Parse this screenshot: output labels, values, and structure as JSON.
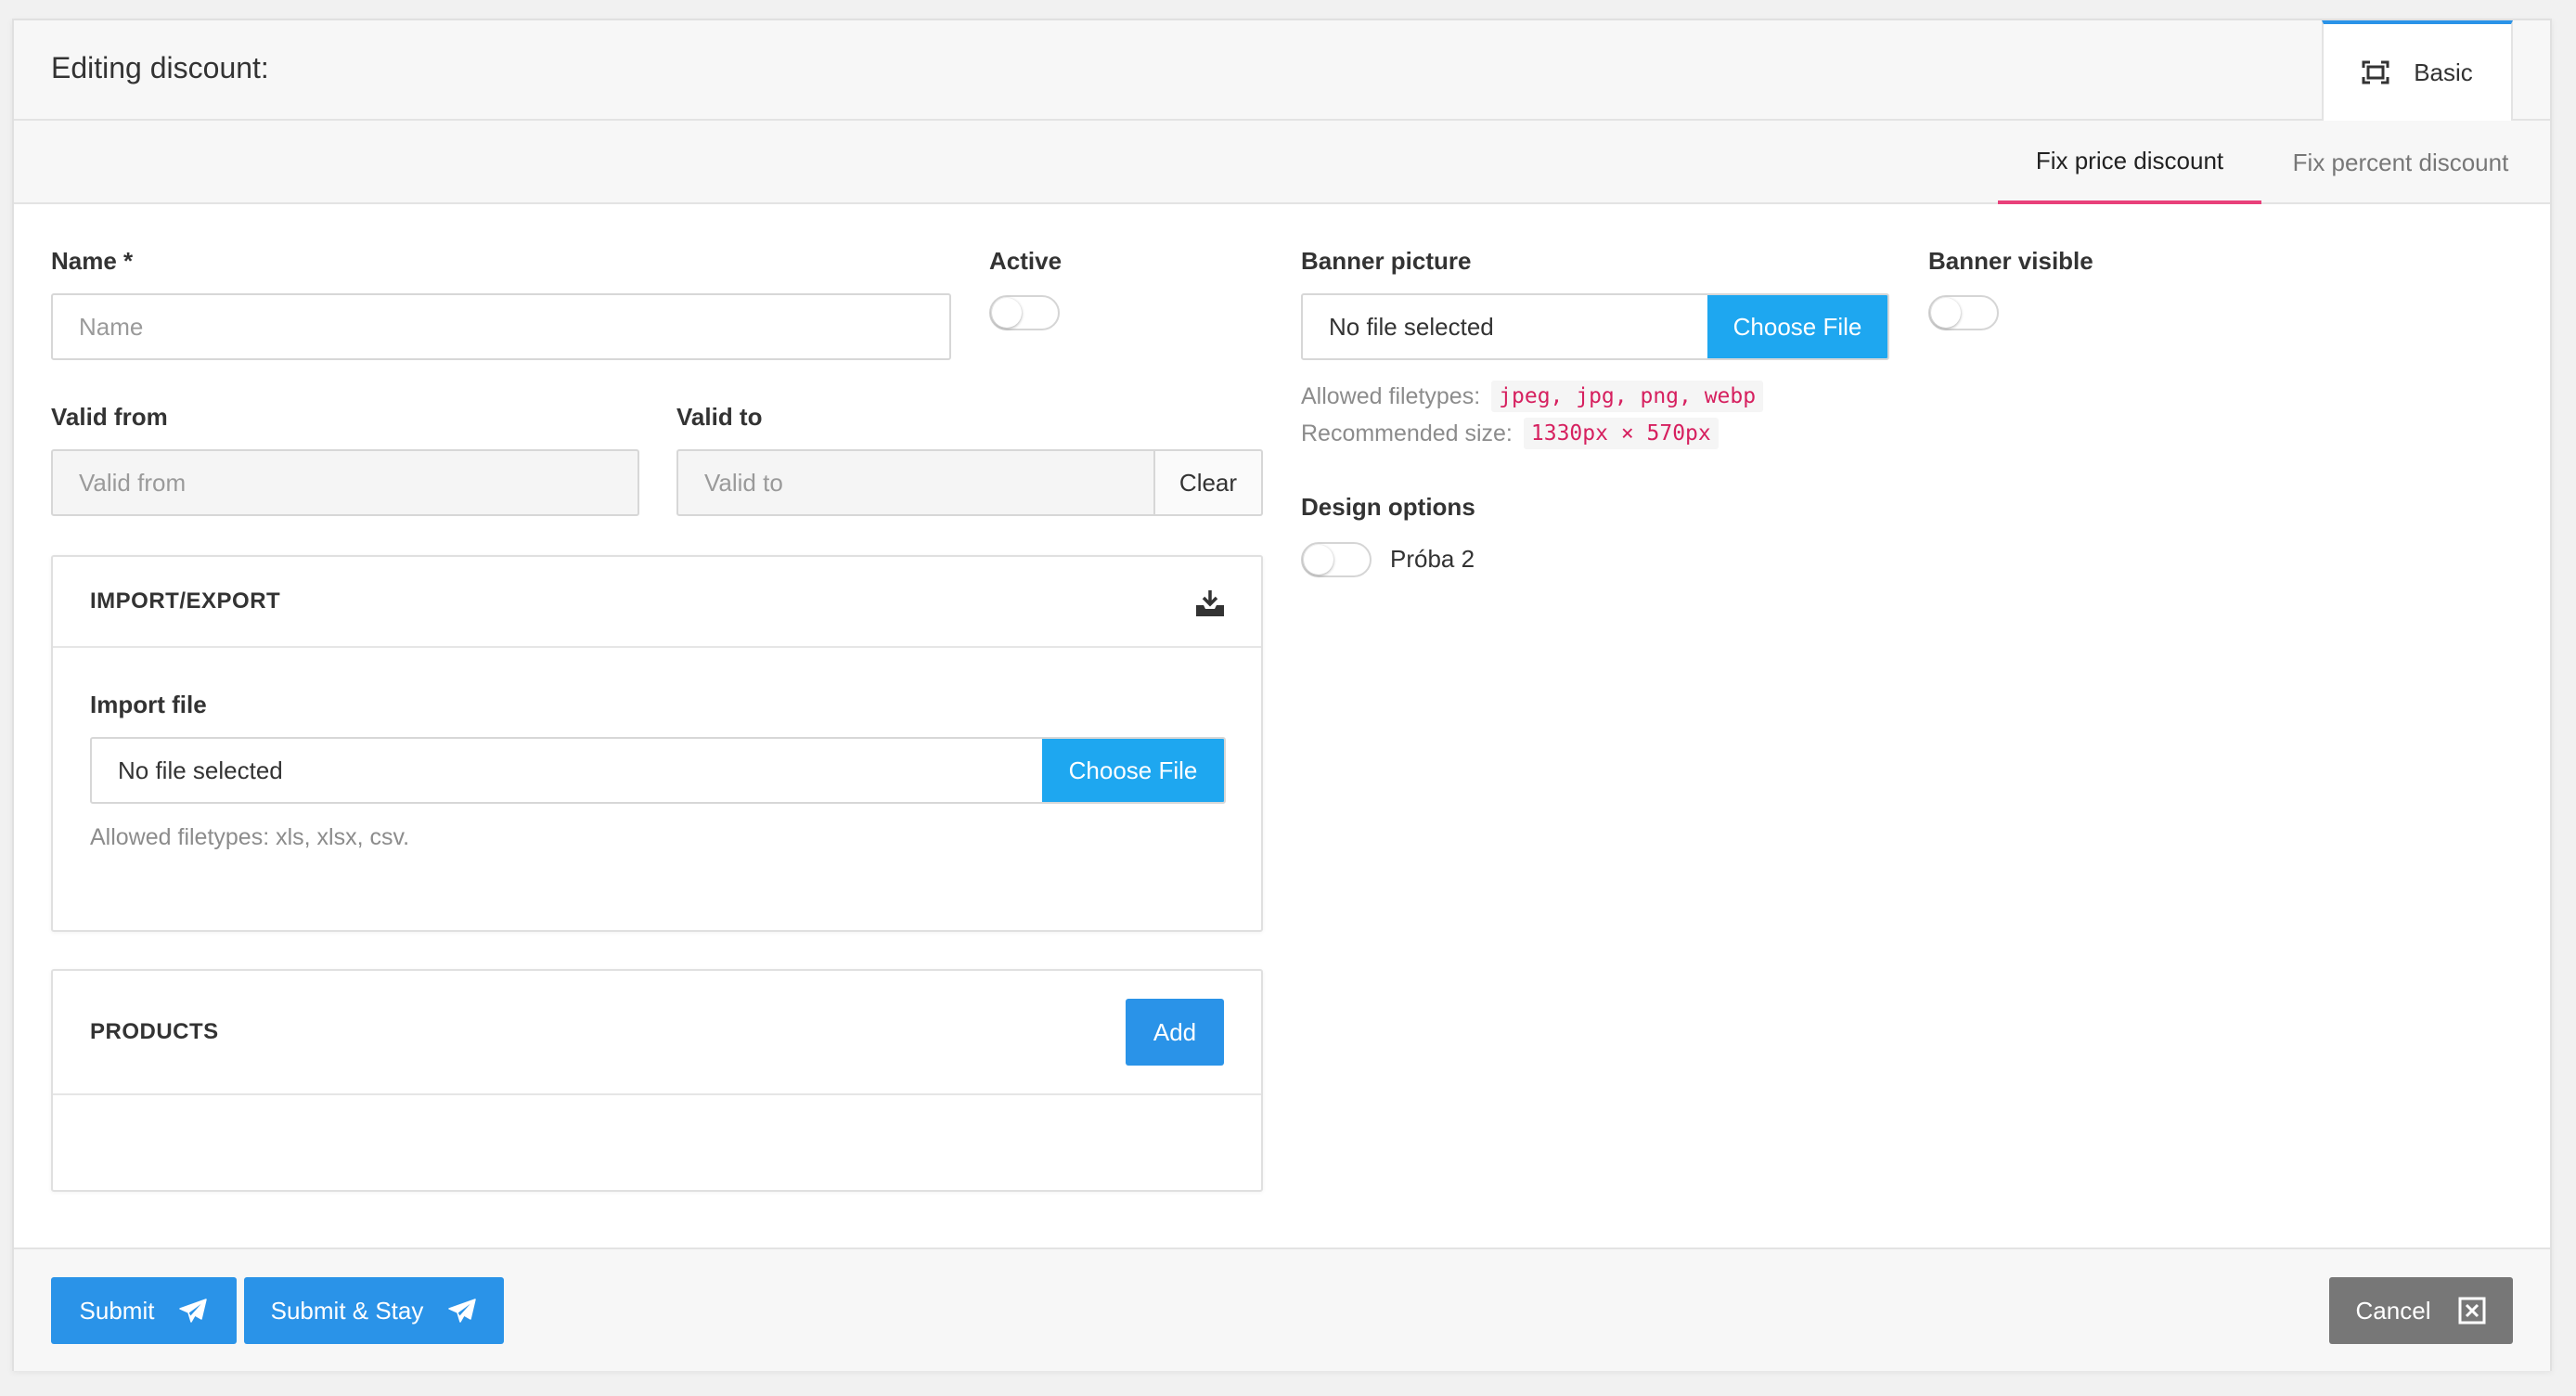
{
  "header": {
    "title": "Editing discount:",
    "view_tab": {
      "label": "Basic",
      "icon": "fullscreen-icon"
    }
  },
  "subtabs": [
    {
      "label": "Fix price discount",
      "active": true
    },
    {
      "label": "Fix percent discount",
      "active": false
    }
  ],
  "form": {
    "name": {
      "label": "Name *",
      "placeholder": "Name",
      "value": ""
    },
    "active": {
      "label": "Active",
      "on": false
    },
    "valid_from": {
      "label": "Valid from",
      "placeholder": "Valid from"
    },
    "valid_to": {
      "label": "Valid to",
      "placeholder": "Valid to",
      "clear_label": "Clear"
    },
    "banner_picture": {
      "label": "Banner picture",
      "file_text": "No file selected",
      "button_label": "Choose File",
      "allowed_label": "Allowed filetypes:",
      "allowed_value": "jpeg, jpg, png, webp",
      "size_label": "Recommended size:",
      "size_value": "1330px × 570px"
    },
    "banner_visible": {
      "label": "Banner visible",
      "on": false
    },
    "design_options": {
      "label": "Design options",
      "options": [
        {
          "label": "Próba 2",
          "on": false
        }
      ]
    }
  },
  "import_export": {
    "title": "IMPORT/EXPORT",
    "icon": "download-tray-icon",
    "import_label": "Import file",
    "file_text": "No file selected",
    "button_label": "Choose File",
    "help": "Allowed filetypes: xls, xlsx, csv."
  },
  "products": {
    "title": "PRODUCTS",
    "add_label": "Add"
  },
  "footer": {
    "submit_label": "Submit",
    "submit_stay_label": "Submit & Stay",
    "cancel_label": "Cancel"
  },
  "colors": {
    "primary": "#2a93e8",
    "file_button": "#1ea7f0",
    "active_tab_underline": "#e9407a",
    "code_text": "#d6205f",
    "cancel_button": "#777777"
  }
}
